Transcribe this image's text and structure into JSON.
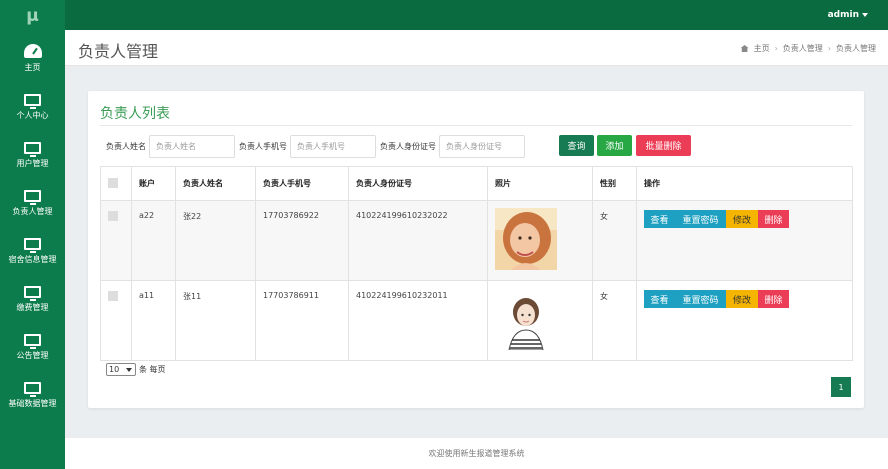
{
  "logo": "μ",
  "sidebar": {
    "items": [
      {
        "label": "主页",
        "icon": "dashboard-icon"
      },
      {
        "label": "个人中心",
        "icon": "monitor-icon"
      },
      {
        "label": "用户管理",
        "icon": "monitor-icon"
      },
      {
        "label": "负责人管理",
        "icon": "monitor-icon"
      },
      {
        "label": "宿舍信息管理",
        "icon": "monitor-icon"
      },
      {
        "label": "缴费管理",
        "icon": "monitor-icon"
      },
      {
        "label": "公告管理",
        "icon": "monitor-icon"
      },
      {
        "label": "基础数据管理",
        "icon": "monitor-icon"
      }
    ]
  },
  "topbar": {
    "user": "admin"
  },
  "header": {
    "title": "负责人管理",
    "breadcrumb": [
      "主页",
      "负责人管理",
      "负责人管理"
    ]
  },
  "card": {
    "title": "负责人列表",
    "filters": [
      {
        "label": "负责人姓名",
        "placeholder": "负责人姓名"
      },
      {
        "label": "负责人手机号",
        "placeholder": "负责人手机号"
      },
      {
        "label": "负责人身份证号",
        "placeholder": "负责人身份证号"
      }
    ],
    "buttons": {
      "query": "查询",
      "add": "添加",
      "batch_delete": "批量删除"
    }
  },
  "table": {
    "columns": [
      "",
      "账户",
      "负责人姓名",
      "负责人手机号",
      "负责人身份证号",
      "照片",
      "性别",
      "操作"
    ],
    "rows": [
      {
        "account": "a22",
        "name": "张22",
        "phone": "17703786922",
        "id_card": "410224199610232022",
        "gender": "女"
      },
      {
        "account": "a11",
        "name": "张11",
        "phone": "17703786911",
        "id_card": "410224199610232011",
        "gender": "女"
      }
    ],
    "actions": {
      "view": "查看",
      "reset": "重置密码",
      "edit": "修改",
      "delete": "删除"
    }
  },
  "pager": {
    "page_size": "10",
    "suffix": "条 每页",
    "current_page": "1"
  },
  "footer": "欢迎使用新生报道管理系统",
  "colors": {
    "sidebar": "#0d7c4c",
    "topbar": "#0b6b40",
    "accent": "#167a52",
    "danger": "#ec3d56",
    "info": "#1da0c1",
    "warning": "#f4b400"
  }
}
